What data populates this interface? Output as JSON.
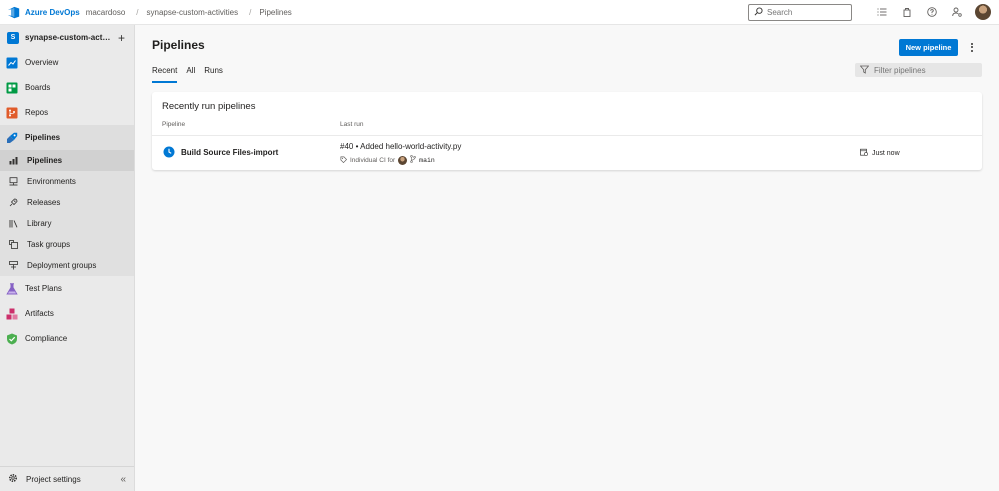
{
  "header": {
    "brand": "Azure DevOps",
    "breadcrumbs": [
      "macardoso",
      "synapse-custom-activities",
      "Pipelines"
    ],
    "separator": "/",
    "search_placeholder": "Search"
  },
  "sidebar": {
    "project_initial": "S",
    "project_name": "synapse-custom-activities",
    "add_glyph": "+",
    "items": [
      {
        "label": "Overview",
        "icon": "overview-icon"
      },
      {
        "label": "Boards",
        "icon": "boards-icon"
      },
      {
        "label": "Repos",
        "icon": "repos-icon"
      },
      {
        "label": "Pipelines",
        "icon": "pipelines-icon"
      },
      {
        "label": "Test Plans",
        "icon": "test-plans-icon"
      },
      {
        "label": "Artifacts",
        "icon": "artifacts-icon"
      },
      {
        "label": "Compliance",
        "icon": "compliance-icon"
      }
    ],
    "sub_items": [
      {
        "label": "Pipelines",
        "icon": "pipelines-sub-icon"
      },
      {
        "label": "Environments",
        "icon": "environments-icon"
      },
      {
        "label": "Releases",
        "icon": "releases-icon"
      },
      {
        "label": "Library",
        "icon": "library-icon"
      },
      {
        "label": "Task groups",
        "icon": "task-groups-icon"
      },
      {
        "label": "Deployment groups",
        "icon": "deployment-groups-icon"
      }
    ],
    "settings_label": "Project settings",
    "collapse_glyph": "«"
  },
  "main": {
    "title": "Pipelines",
    "new_button": "New pipeline",
    "tabs": [
      "Recent",
      "All",
      "Runs"
    ],
    "filter_placeholder": "Filter pipelines",
    "card": {
      "title": "Recently run pipelines",
      "col_pipeline": "Pipeline",
      "col_last_run": "Last run",
      "rows": [
        {
          "pipeline": "Build Source Files-import",
          "run_title": "#40 • Added hello-world-activity.py",
          "trigger": "Individual CI for",
          "branch": "main",
          "time": "Just now"
        }
      ]
    }
  },
  "colors": {
    "accent": "#0078d4",
    "boards": "#009a44",
    "repos": "#e05b2a",
    "test_plans": "#8661c5",
    "artifacts": "#cc2f6b",
    "compliance": "#4caf50"
  }
}
